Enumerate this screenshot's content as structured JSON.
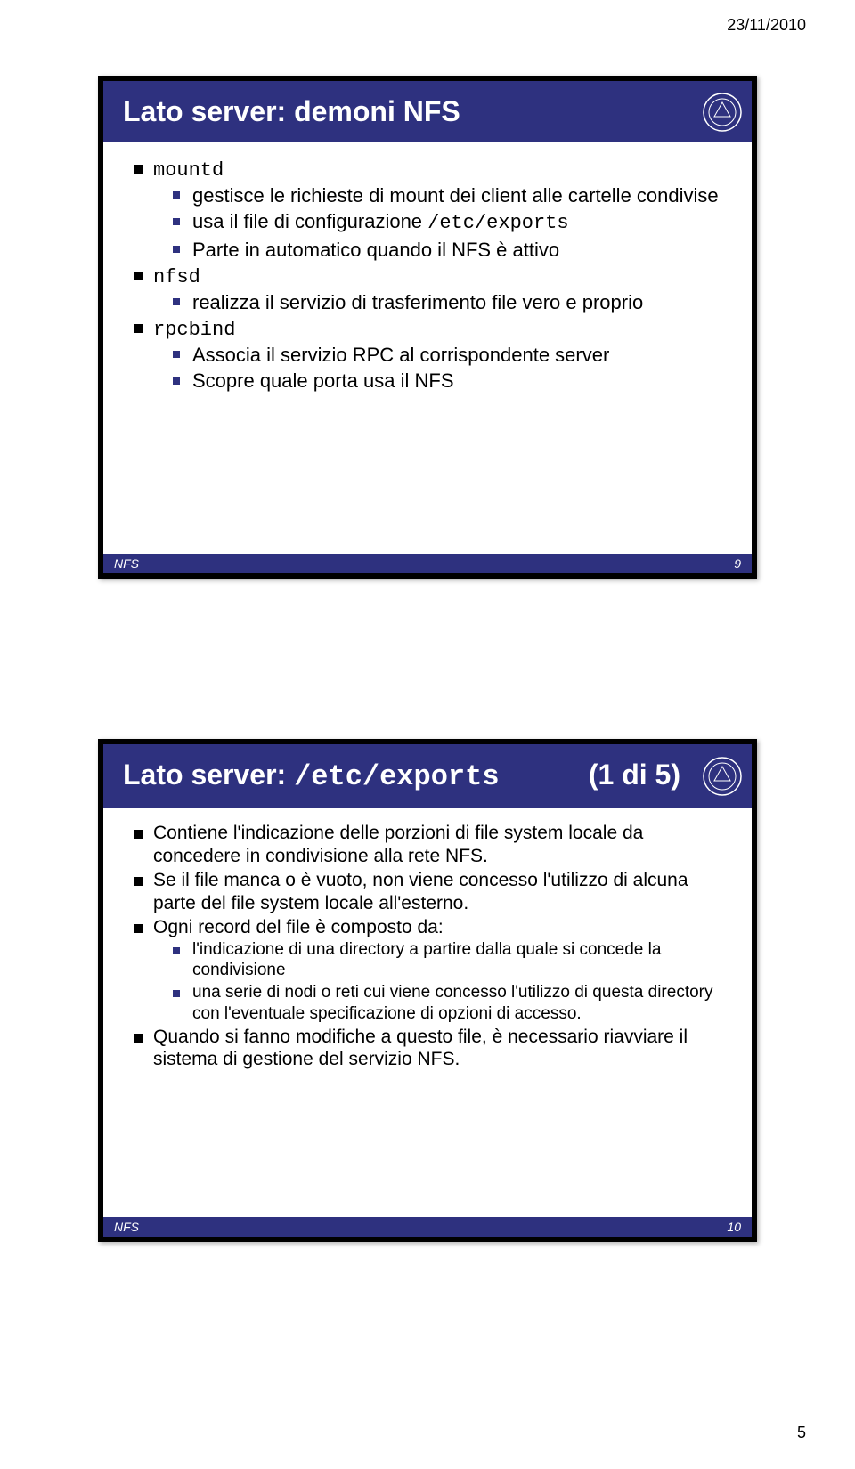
{
  "page": {
    "date": "23/11/2010",
    "number": "5"
  },
  "slide1": {
    "title": "Lato server: demoni NFS",
    "footer_label": "NFS",
    "footer_num": "9",
    "b1": {
      "text": "mountd"
    },
    "b1_1": {
      "text": "gestisce le richieste di mount dei client alle cartelle condivise"
    },
    "b1_2_a": "usa il file di configurazione ",
    "b1_2_b": "/etc/exports",
    "b1_3": {
      "text": "Parte in automatico quando il NFS è attivo"
    },
    "b2": {
      "text": "nfsd"
    },
    "b2_1": {
      "text": "realizza il servizio di trasferimento file vero e proprio"
    },
    "b3": {
      "text": "rpcbind"
    },
    "b3_1": {
      "text": "Associa il servizio RPC al corrispondente server"
    },
    "b3_2": {
      "text": "Scopre quale porta usa il NFS"
    }
  },
  "slide2": {
    "title_a": "Lato server: ",
    "title_b": "/etc/exports",
    "title_part": "(1 di 5)",
    "footer_label": "NFS",
    "footer_num": "10",
    "c1": "Contiene l'indicazione delle porzioni di file system locale da concedere in condivisione alla rete NFS.",
    "c2": "Se il file manca o è vuoto, non viene concesso l'utilizzo di alcuna parte del file system locale all'esterno.",
    "c3": "Ogni record del file è composto da:",
    "c3_1": "l'indicazione di una directory a partire dalla quale si concede la condivisione",
    "c3_2": "una serie di nodi o reti cui viene concesso l'utilizzo di questa directory con l'eventuale specificazione di opzioni di accesso.",
    "c4": "Quando si fanno modifiche a questo file, è necessario riavviare il sistema di gestione del servizio NFS."
  }
}
